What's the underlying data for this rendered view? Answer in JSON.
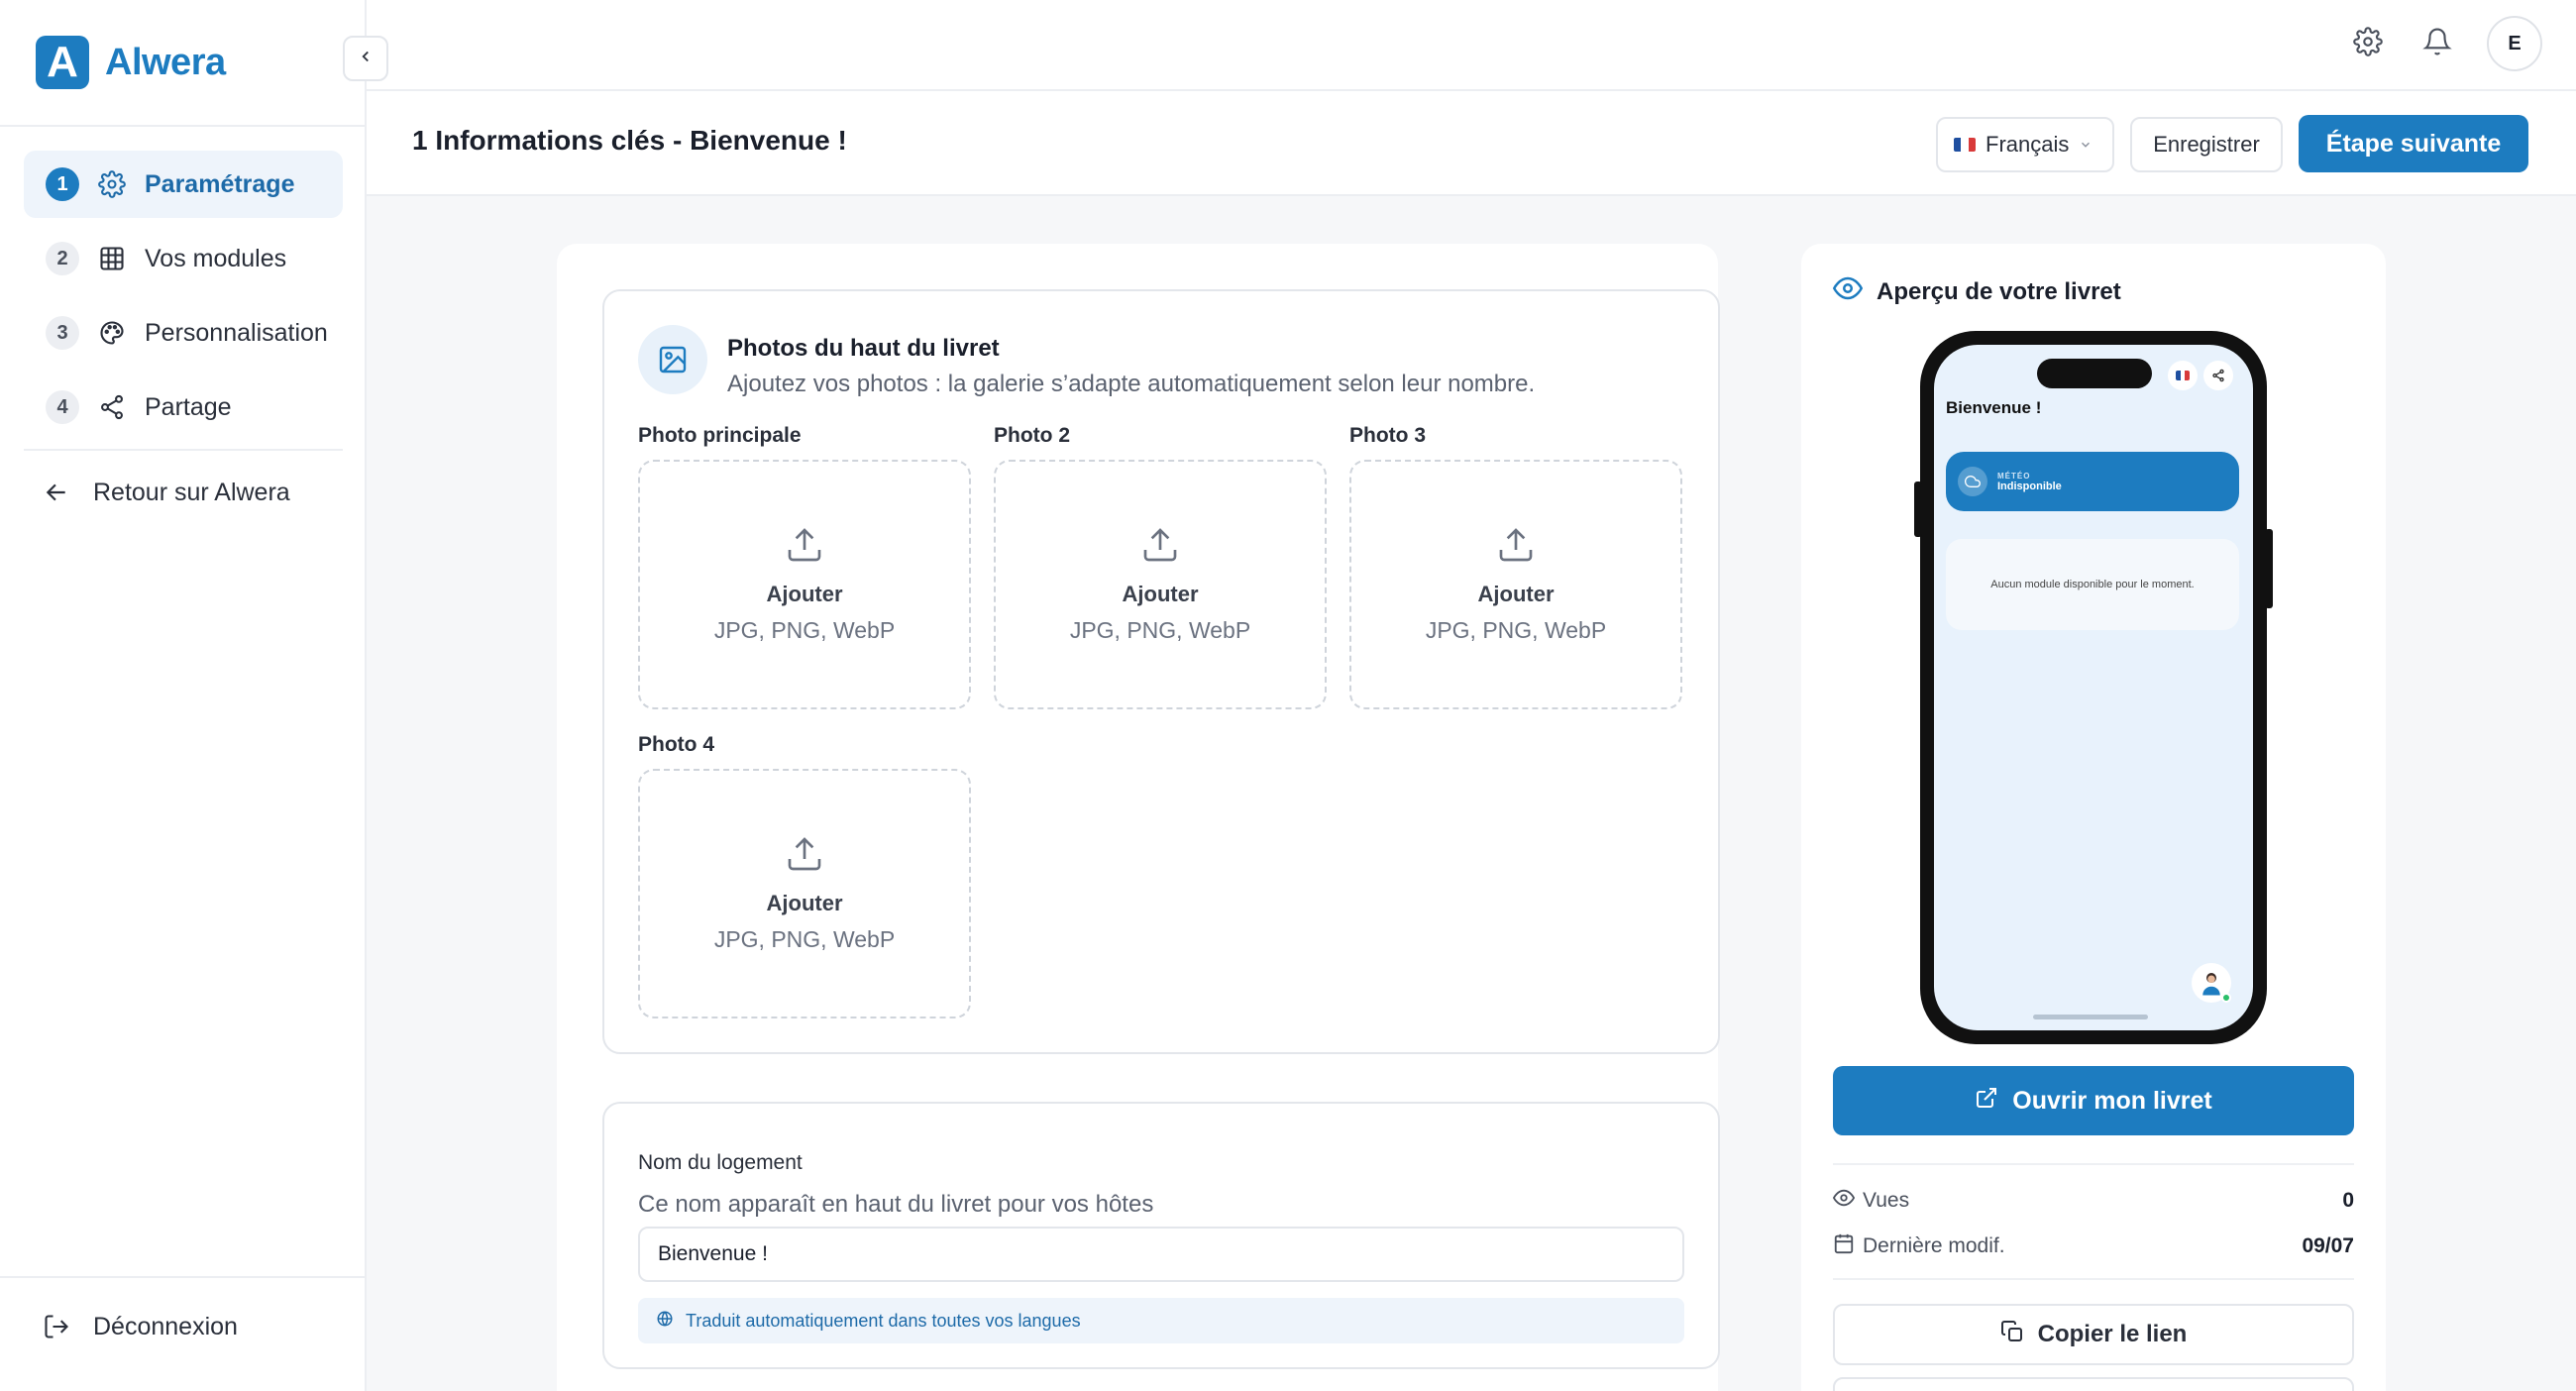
{
  "brand": {
    "name": "Alwera",
    "logo_letter": "A",
    "color": "#1d7cc0"
  },
  "sidebar": {
    "items": [
      {
        "num": "1",
        "label": "Paramétrage",
        "icon": "gear-icon",
        "active": true
      },
      {
        "num": "2",
        "label": "Vos modules",
        "icon": "grid-icon",
        "active": false
      },
      {
        "num": "3",
        "label": "Personnalisation",
        "icon": "palette-icon",
        "active": false
      },
      {
        "num": "4",
        "label": "Partage",
        "icon": "share-icon",
        "active": false
      }
    ],
    "back_label": "Retour sur Alwera",
    "logout_label": "Déconnexion"
  },
  "topbar": {
    "avatar_initial": "E"
  },
  "header": {
    "title": "1 Informations clés - Bienvenue !",
    "language": "Français",
    "save_label": "Enregistrer",
    "next_label": "Étape suivante"
  },
  "photos_section": {
    "title": "Photos du haut du livret",
    "subtitle": "Ajoutez vos photos : la galerie s’adapte automatiquement selon leur nombre.",
    "slots": [
      {
        "label": "Photo principale",
        "action": "Ajouter",
        "formats": "JPG, PNG, WebP"
      },
      {
        "label": "Photo 2",
        "action": "Ajouter",
        "formats": "JPG, PNG, WebP"
      },
      {
        "label": "Photo 3",
        "action": "Ajouter",
        "formats": "JPG, PNG, WebP"
      },
      {
        "label": "Photo 4",
        "action": "Ajouter",
        "formats": "JPG, PNG, WebP"
      }
    ]
  },
  "name_section": {
    "label": "Nom du logement",
    "help": "Ce nom apparaît en haut du livret pour vos hôtes",
    "value": "Bienvenue !",
    "translate_note": "Traduit automatiquement dans toutes vos langues"
  },
  "preview": {
    "title": "Aperçu de votre livret",
    "phone": {
      "title": "Bienvenue !",
      "weather_caption": "MÉTÉO",
      "weather_value": "Indisponible",
      "empty_message": "Aucun module disponible pour le moment."
    },
    "open_label": "Ouvrir mon livret",
    "stats": [
      {
        "label": "Vues",
        "value": "0",
        "icon": "eye-icon"
      },
      {
        "label": "Dernière modif.",
        "value": "09/07",
        "icon": "calendar-icon"
      }
    ],
    "copy_label": "Copier le lien"
  }
}
